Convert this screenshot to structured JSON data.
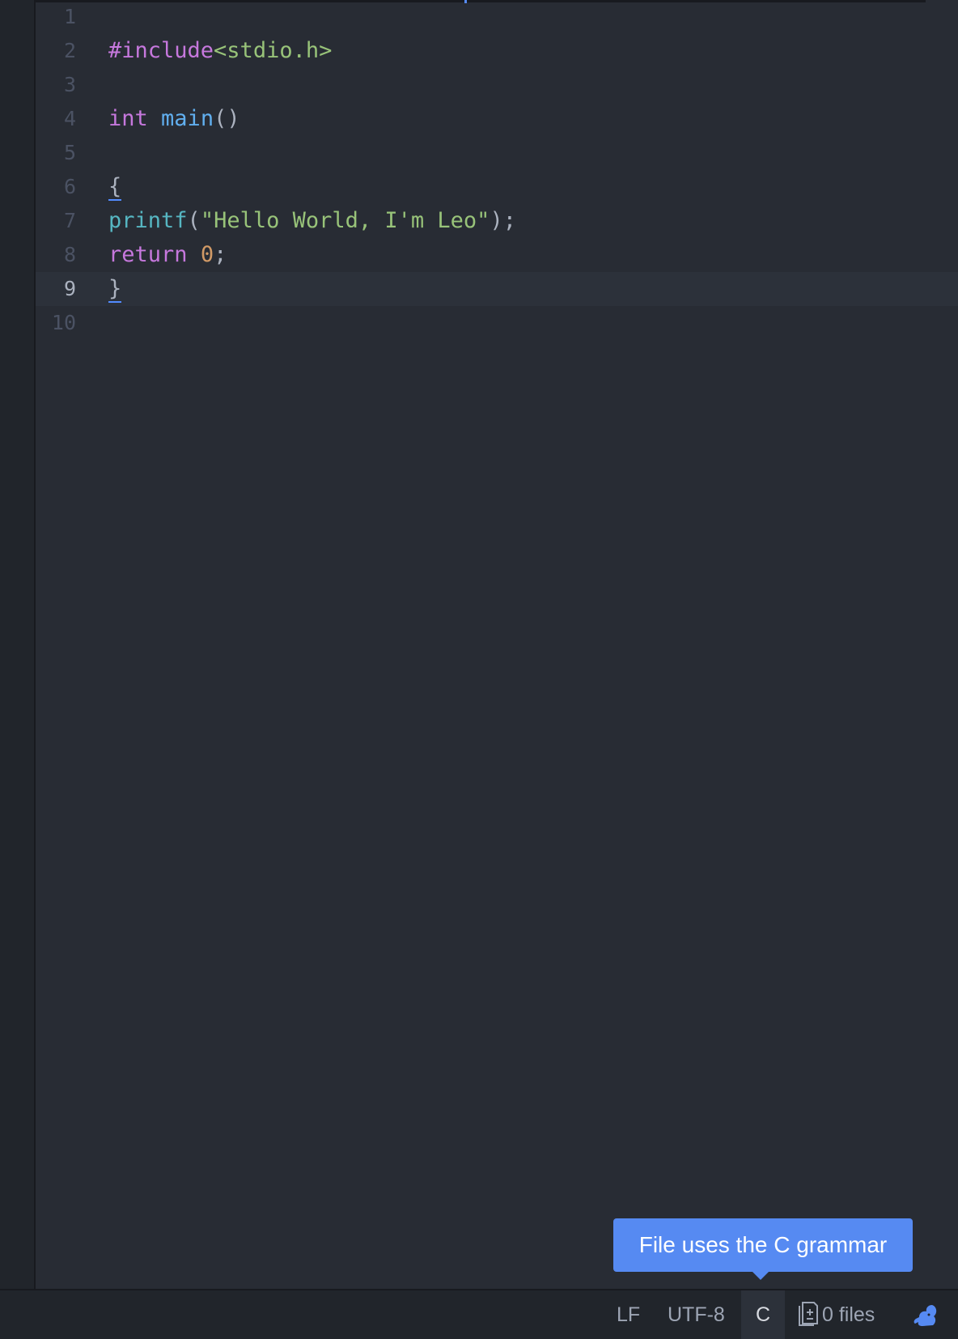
{
  "editor": {
    "lines": [
      {
        "number": "1",
        "tokens": []
      },
      {
        "number": "2",
        "tokens": [
          {
            "t": "#include",
            "c": "preproc"
          },
          {
            "t": "<stdio.h>",
            "c": "header"
          }
        ]
      },
      {
        "number": "3",
        "tokens": []
      },
      {
        "number": "4",
        "tokens": [
          {
            "t": "int",
            "c": "keyword"
          },
          {
            "t": " ",
            "c": "punct"
          },
          {
            "t": "main",
            "c": "function"
          },
          {
            "t": "()",
            "c": "punct"
          }
        ]
      },
      {
        "number": "5",
        "tokens": []
      },
      {
        "number": "6",
        "tokens": [
          {
            "t": "{",
            "c": "punct",
            "match": true
          }
        ]
      },
      {
        "number": "7",
        "tokens": [
          {
            "t": "printf",
            "c": "builtin"
          },
          {
            "t": "(",
            "c": "punct"
          },
          {
            "t": "\"Hello World, I'm Leo\"",
            "c": "string"
          },
          {
            "t": ");",
            "c": "punct"
          }
        ]
      },
      {
        "number": "8",
        "tokens": [
          {
            "t": "return",
            "c": "keyword"
          },
          {
            "t": " ",
            "c": "punct"
          },
          {
            "t": "0",
            "c": "number"
          },
          {
            "t": ";",
            "c": "punct"
          }
        ]
      },
      {
        "number": "9",
        "tokens": [
          {
            "t": "}",
            "c": "punct",
            "match": true
          }
        ],
        "cursor": true
      },
      {
        "number": "10",
        "tokens": []
      }
    ]
  },
  "tooltip": {
    "text": "File uses the C grammar"
  },
  "status_bar": {
    "line_ending": "LF",
    "encoding": "UTF-8",
    "grammar": "C",
    "files_label": "0 files",
    "files_icon": "file-diff-icon",
    "squirrel_icon": "squirrel-icon"
  },
  "colors": {
    "background": "#282c34",
    "accent": "#568af2",
    "keyword": "#c678dd",
    "string": "#98c379",
    "function": "#61afef",
    "builtin": "#56b6c2",
    "number": "#d19a66"
  }
}
